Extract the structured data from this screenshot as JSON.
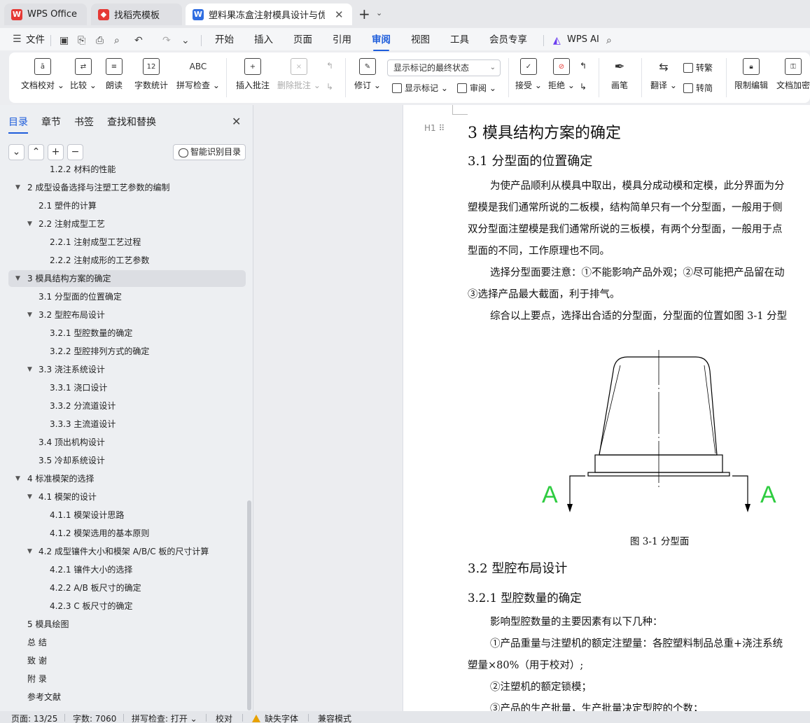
{
  "tabs": [
    {
      "label": "WPS Office",
      "icon": "wps-logo-icon",
      "color": "#e53935"
    },
    {
      "label": "找稻壳模板",
      "icon": "docer-logo-icon",
      "color": "#e53935"
    },
    {
      "label": "塑料果冻盒注射模具设计与优化",
      "icon": "wps-writer-icon",
      "color": "#2f6de1"
    }
  ],
  "menubar": {
    "file": "文件",
    "items": [
      "开始",
      "插入",
      "页面",
      "引用",
      "审阅",
      "视图",
      "工具",
      "会员专享"
    ],
    "active": "审阅",
    "ai": "WPS AI"
  },
  "ribbon": {
    "doc_check": "文档校对",
    "compare": "比较",
    "read_aloud": "朗读",
    "word_count": "字数统计",
    "word_count_icon_text": "12",
    "spell_check": "拼写检查",
    "spell_icon_text": "ABC",
    "insert_comment": "插入批注",
    "delete_comment": "删除批注",
    "track_changes": "修订",
    "markup_state": "显示标记的最终状态",
    "show_markup": "显示标记",
    "review": "审阅",
    "accept": "接受",
    "reject": "拒绝",
    "pen": "画笔",
    "translate": "翻译",
    "to_traditional": "转繁",
    "to_simplified": "转简",
    "restrict_edit": "限制编辑",
    "doc_encrypt": "文档加密"
  },
  "nav": {
    "tabs": [
      "目录",
      "章节",
      "书签",
      "查找和替换"
    ],
    "active_tab": "目录",
    "smart_button": "智能识别目录",
    "toc": [
      {
        "text": "1.2.2 材料的性能",
        "level": 3,
        "arrow": false
      },
      {
        "text": "2 成型设备选择与注塑工艺参数的编制",
        "level": 1,
        "arrow": true
      },
      {
        "text": "2.1 塑件的计算",
        "level": 2,
        "arrow": false
      },
      {
        "text": "2.2 注射成型工艺",
        "level": 2,
        "arrow": true
      },
      {
        "text": "2.2.1 注射成型工艺过程",
        "level": 3,
        "arrow": false
      },
      {
        "text": "2.2.2 注射成形的工艺参数",
        "level": 3,
        "arrow": false
      },
      {
        "text": "3 模具结构方案的确定",
        "level": 1,
        "arrow": true,
        "selected": true
      },
      {
        "text": "3.1 分型面的位置确定",
        "level": 2,
        "arrow": false
      },
      {
        "text": "3.2 型腔布局设计",
        "level": 2,
        "arrow": true
      },
      {
        "text": "3.2.1 型腔数量的确定",
        "level": 3,
        "arrow": false
      },
      {
        "text": "3.2.2 型腔排列方式的确定",
        "level": 3,
        "arrow": false
      },
      {
        "text": "3.3 浇注系统设计",
        "level": 2,
        "arrow": true
      },
      {
        "text": "3.3.1 浇口设计",
        "level": 3,
        "arrow": false
      },
      {
        "text": "3.3.2 分流道设计",
        "level": 3,
        "arrow": false
      },
      {
        "text": "3.3.3 主流道设计",
        "level": 3,
        "arrow": false
      },
      {
        "text": "3.4 顶出机构设计",
        "level": 2,
        "arrow": false
      },
      {
        "text": "3.5 冷却系统设计",
        "level": 2,
        "arrow": false
      },
      {
        "text": "4 标准模架的选择",
        "level": 1,
        "arrow": true
      },
      {
        "text": "4.1 模架的设计",
        "level": 2,
        "arrow": true
      },
      {
        "text": "4.1.1 模架设计思路",
        "level": 3,
        "arrow": false
      },
      {
        "text": "4.1.2 模架选用的基本原则",
        "level": 3,
        "arrow": false
      },
      {
        "text": "4.2 成型镶件大小和模架 A/B/C 板的尺寸计算",
        "level": 2,
        "arrow": true
      },
      {
        "text": "4.2.1 镶件大小的选择",
        "level": 3,
        "arrow": false
      },
      {
        "text": "4.2.2  A/B 板尺寸的确定",
        "level": 3,
        "arrow": false
      },
      {
        "text": "4.2.3  C 板尺寸的确定",
        "level": 3,
        "arrow": false
      },
      {
        "text": "5 模具绘图",
        "level": 1,
        "arrow": false
      },
      {
        "text": "总 结",
        "level": 1,
        "arrow": false
      },
      {
        "text": "致 谢",
        "level": 1,
        "arrow": false
      },
      {
        "text": "附 录",
        "level": 1,
        "arrow": false
      },
      {
        "text": "参考文献",
        "level": 1,
        "arrow": false
      }
    ]
  },
  "doc": {
    "heading_marker": "H1",
    "h1": "3  模具结构方案的确定",
    "h2_1": "3.1  分型面的位置确定",
    "p1": "为使产品顺利从模具中取出，模具分成动模和定模，此分界面为分",
    "p2": "塑模是我们通常所说的二板模，结构简单只有一个分型面，一般用于侧",
    "p3": "双分型面注塑模是我们通常所说的三板模，有两个分型面，一般用于点",
    "p4": "型面的不同，工作原理也不同。",
    "p5": "选择分型面要注意：①不能影响产品外观；②尽可能把产品留在动",
    "p6": "③选择产品最大截面，利于排气。",
    "p7": "综合以上要点，选择出合适的分型面，分型面的位置如图 3-1 分型",
    "figure_label_left": "A",
    "figure_label_right": "A",
    "caption": "图 3-1 分型面",
    "h2_2": "3.2  型腔布局设计",
    "h3_1": "3.2.1  型腔数量的确定",
    "p8": "影响型腔数量的主要因素有以下几种：",
    "p9": "①产品重量与注塑机的额定注塑量：各腔塑料制品总重+浇注系统",
    "p10": "塑量×80%（用于校对）;",
    "p11": "②注塑机的额定锁模；",
    "p12": "③产品的生产批量，生产批量决定型腔的个数；"
  },
  "status": {
    "page": "页面: 13/25",
    "words": "字数: 7060",
    "spell": "拼写检查: 打开",
    "proof": "校对",
    "missing_font": "缺失字体",
    "compat": "兼容模式"
  },
  "colors": {
    "accent": "#1e5ddb",
    "figure_green": "#2ecc40",
    "warning": "#e8a100"
  }
}
